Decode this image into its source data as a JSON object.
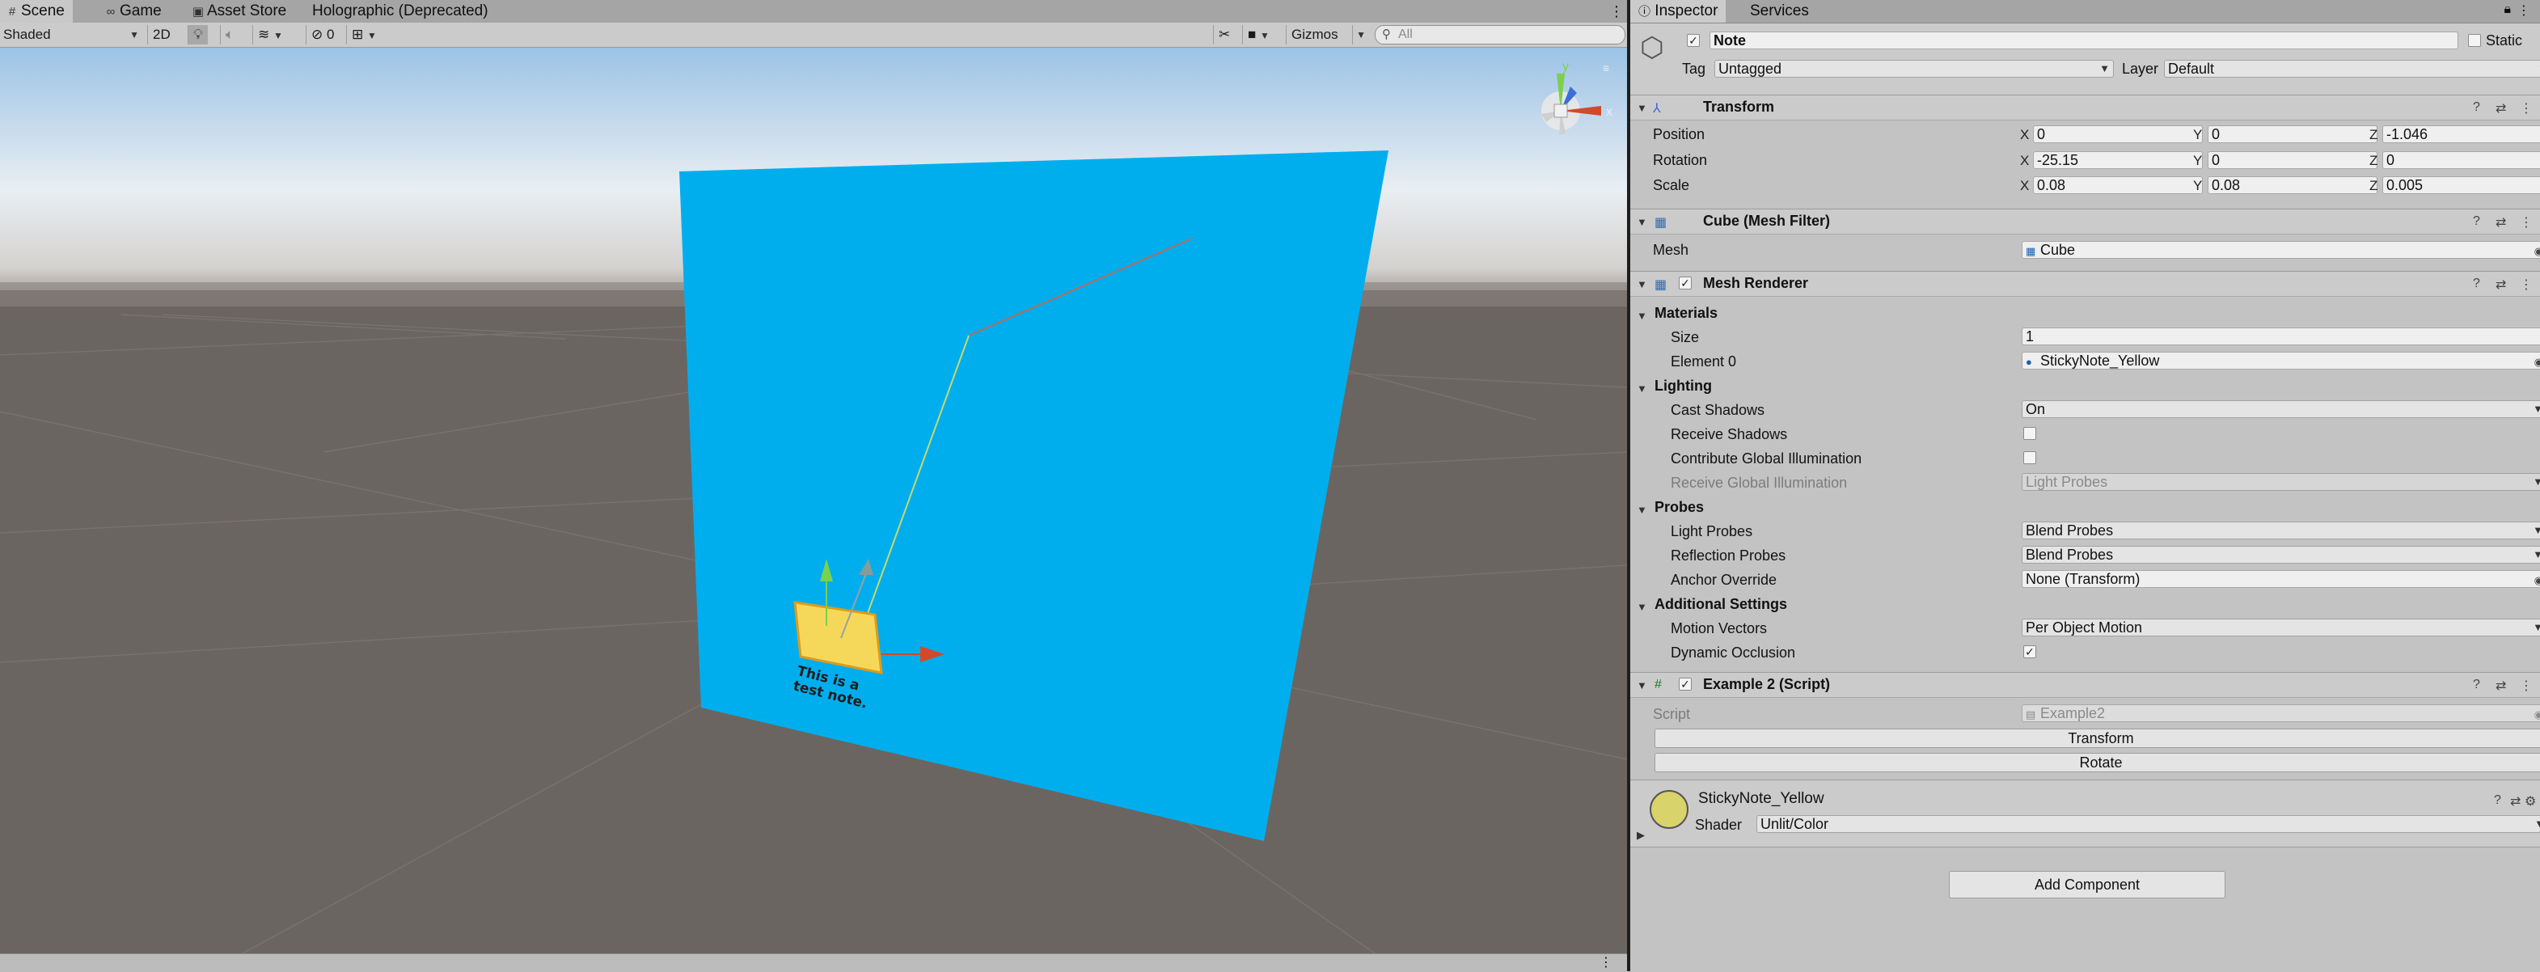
{
  "scene_tabs": [
    {
      "label": "Scene",
      "icon": "grid-icon"
    },
    {
      "label": "Game",
      "icon": "gamepad-icon"
    },
    {
      "label": "Asset Store",
      "icon": "store-icon"
    },
    {
      "label": "Holographic (Deprecated)",
      "icon": ""
    }
  ],
  "toolbar": {
    "shading_mode": "Shaded",
    "mode_2d": "2D",
    "hidden_count": "0",
    "gizmos_label": "Gizmos",
    "search_placeholder": "All"
  },
  "sticky_note_text": "This is a test note.",
  "inspector_tabs": [
    {
      "label": "Inspector",
      "icon": "info-icon"
    },
    {
      "label": "Services",
      "icon": ""
    }
  ],
  "object": {
    "name": "Note",
    "static_label": "Static",
    "tag_label": "Tag",
    "tag_value": "Untagged",
    "layer_label": "Layer",
    "layer_value": "Default"
  },
  "transform": {
    "title": "Transform",
    "rows": [
      {
        "label": "Position",
        "x": "0",
        "y": "0",
        "z": "-1.046"
      },
      {
        "label": "Rotation",
        "x": "-25.15",
        "y": "0",
        "z": "0"
      },
      {
        "label": "Scale",
        "x": "0.08",
        "y": "0.08",
        "z": "0.005"
      }
    ],
    "axis_x": "X",
    "axis_y": "Y",
    "axis_z": "Z"
  },
  "mesh_filter": {
    "title": "Cube (Mesh Filter)",
    "mesh_label": "Mesh",
    "mesh_value": "Cube"
  },
  "mesh_renderer": {
    "title": "Mesh Renderer",
    "materials_label": "Materials",
    "size_label": "Size",
    "size_value": "1",
    "element0_label": "Element 0",
    "element0_value": "StickyNote_Yellow",
    "lighting_label": "Lighting",
    "cast_shadows_label": "Cast Shadows",
    "cast_shadows_value": "On",
    "receive_shadows_label": "Receive Shadows",
    "contribute_gi_label": "Contribute Global Illumination",
    "receive_gi_label": "Receive Global Illumination",
    "receive_gi_value": "Light Probes",
    "probes_label": "Probes",
    "light_probes_label": "Light Probes",
    "light_probes_value": "Blend Probes",
    "reflection_probes_label": "Reflection Probes",
    "reflection_probes_value": "Blend Probes",
    "anchor_override_label": "Anchor Override",
    "anchor_override_value": "None (Transform)",
    "additional_settings_label": "Additional Settings",
    "motion_vectors_label": "Motion Vectors",
    "motion_vectors_value": "Per Object Motion",
    "dynamic_occlusion_label": "Dynamic Occlusion"
  },
  "script_component": {
    "title": "Example 2 (Script)",
    "script_label": "Script",
    "script_value": "Example2",
    "transform_button": "Transform",
    "rotate_button": "Rotate"
  },
  "material": {
    "name": "StickyNote_Yellow",
    "shader_label": "Shader",
    "shader_value": "Unlit/Color",
    "swatch_color": "#d8d36a"
  },
  "add_component_label": "Add Component",
  "colors": {
    "plane_blue": "#00aeee",
    "ground": "#6b6561",
    "sky_top": "#9cc3e6"
  }
}
